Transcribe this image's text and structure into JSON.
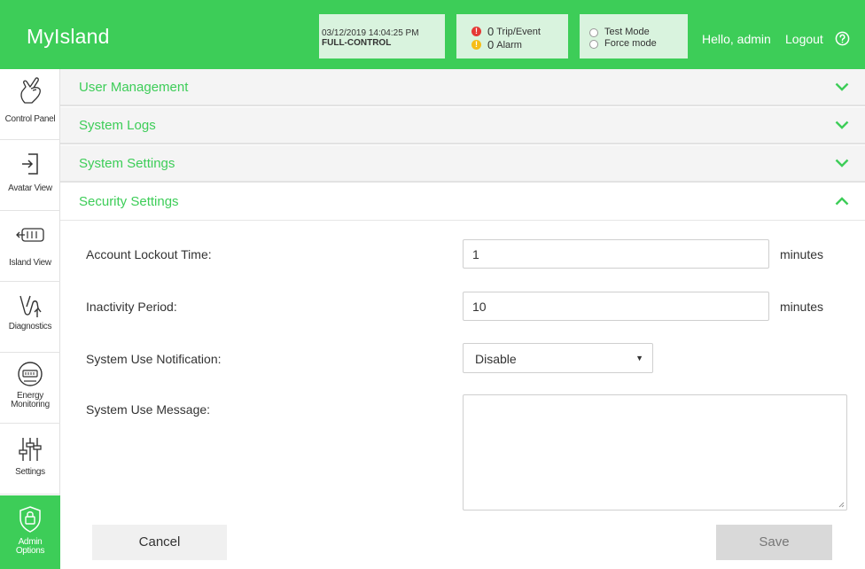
{
  "app": {
    "title": "MyIsland"
  },
  "header": {
    "datetime": "03/12/2019 14:04:25 PM",
    "control_mode": "FULL-CONTROL",
    "trip_event_count": "0",
    "trip_event_label": "Trip/Event",
    "alarm_count": "0",
    "alarm_label": "Alarm",
    "test_mode_label": "Test Mode",
    "force_mode_label": "Force mode",
    "greeting": "Hello, admin",
    "logout_label": "Logout"
  },
  "sidebar": {
    "items": [
      {
        "label": "Control Panel",
        "icon": "hand-pointer-icon"
      },
      {
        "label": "Avatar View",
        "icon": "login-door-icon"
      },
      {
        "label": "Island View",
        "icon": "island-rack-icon"
      },
      {
        "label": "Diagnostics",
        "icon": "stethoscope-icon"
      },
      {
        "label": "Energy Monitoring",
        "label_line1": "Energy",
        "label_line2": "Monitoring",
        "icon": "meter-icon"
      },
      {
        "label": "Settings",
        "icon": "sliders-icon"
      },
      {
        "label": "Admin Options",
        "label_line1": "Admin",
        "label_line2": "Options",
        "icon": "shield-lock-icon",
        "active": true
      }
    ]
  },
  "sections": [
    {
      "title": "User Management",
      "expanded": false
    },
    {
      "title": "System Logs",
      "expanded": false
    },
    {
      "title": "System Settings",
      "expanded": false
    },
    {
      "title": "Security Settings",
      "expanded": true
    }
  ],
  "security_form": {
    "lockout_label": "Account Lockout Time:",
    "lockout_value": "1",
    "lockout_unit": "minutes",
    "inactivity_label": "Inactivity Period:",
    "inactivity_value": "10",
    "inactivity_unit": "minutes",
    "notification_label": "System Use Notification:",
    "notification_value": "Disable",
    "message_label": "System Use Message:",
    "message_value": ""
  },
  "buttons": {
    "cancel": "Cancel",
    "save": "Save"
  },
  "colors": {
    "brand_green": "#3dcd58",
    "header_box": "#d9f3de",
    "trip_red": "#e53935",
    "alarm_yellow": "#f6bd16"
  }
}
